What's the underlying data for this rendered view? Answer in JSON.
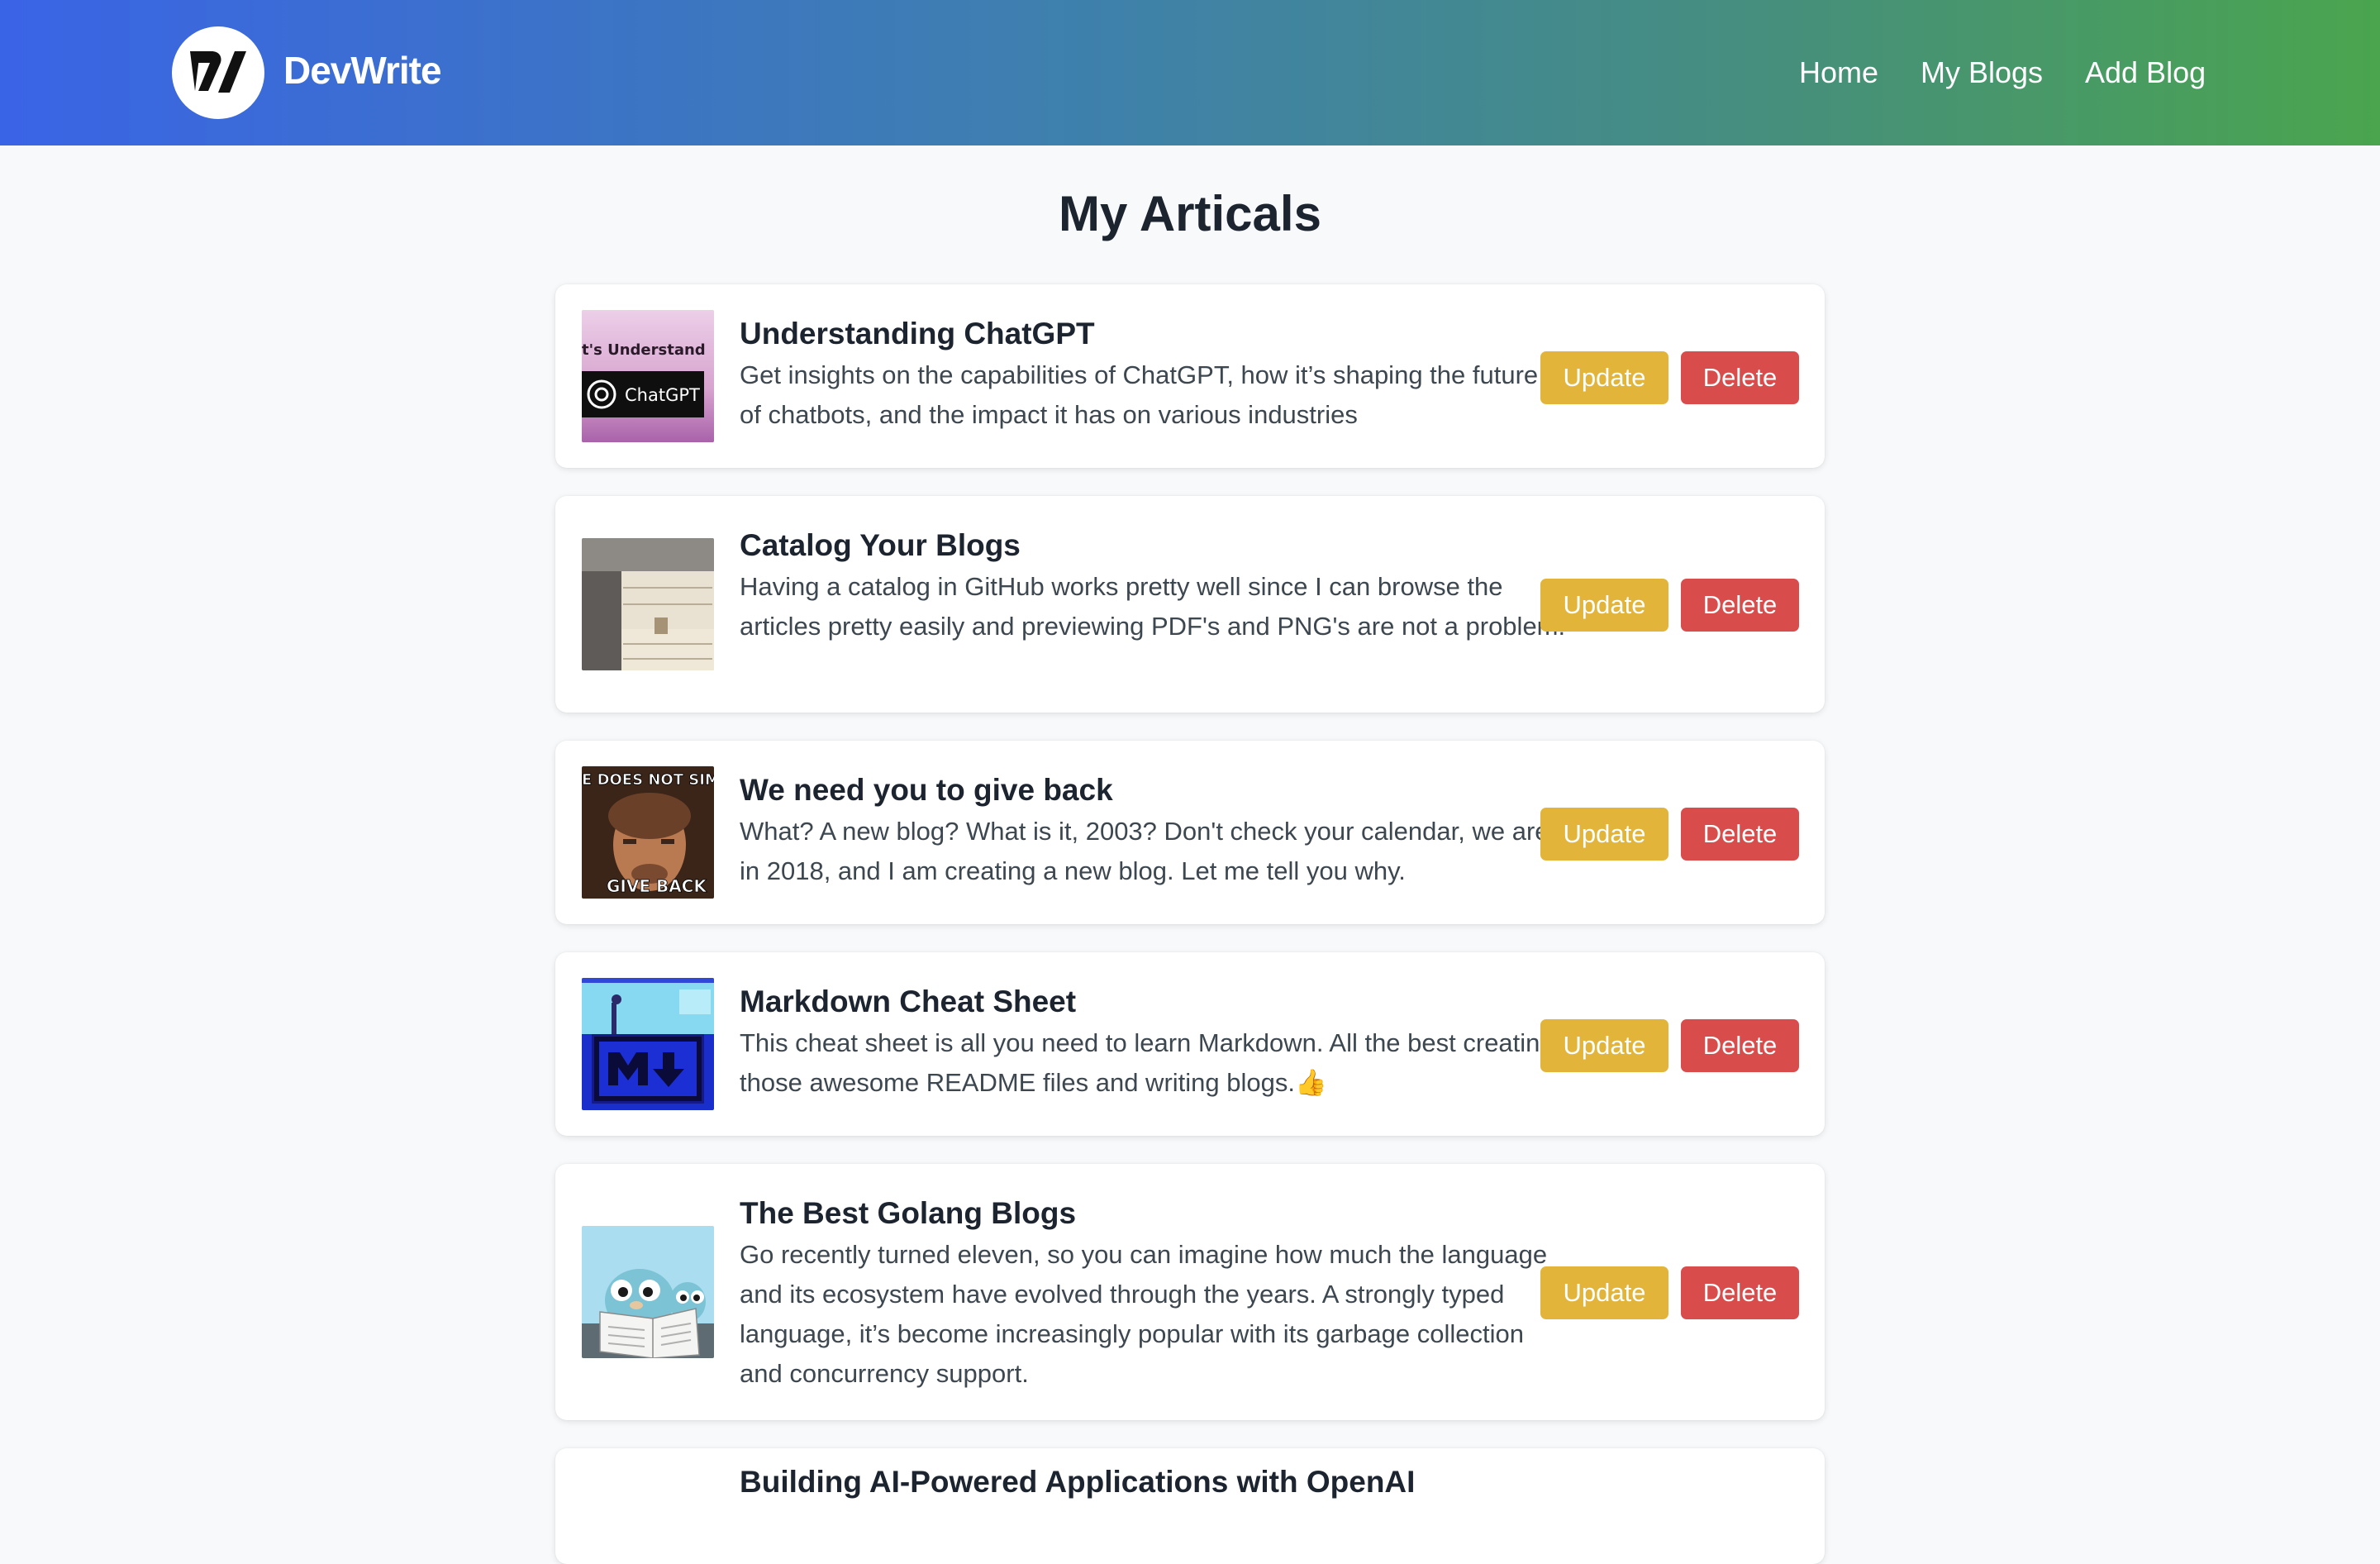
{
  "header": {
    "brand": "DevWrite",
    "nav": [
      {
        "label": "Home"
      },
      {
        "label": "My Blogs"
      },
      {
        "label": "Add Blog"
      }
    ],
    "gradient": [
      "#3a64e6",
      "#468f7c",
      "#4aa54e"
    ]
  },
  "page": {
    "title": "My Articals"
  },
  "actions": {
    "update_label": "Update",
    "delete_label": "Delete",
    "update_color": "#e2b43a",
    "delete_color": "#d94c4c"
  },
  "articles": [
    {
      "title": "Understanding ChatGPT",
      "description": "Get insights on the capabilities of ChatGPT, how it’s shaping the future of chatbots, and the impact it has on various industries",
      "thumb_text_top": "t's Understand",
      "thumb_text_badge": "ChatGPT"
    },
    {
      "title": "Catalog Your Blogs",
      "description": "Having a catalog in GitHub works pretty well since I can browse the articles pretty easily and previewing PDF's and PNG's are not a problem."
    },
    {
      "title": "We need you to give back",
      "description": "What? A new blog? What is it, 2003? Don't check your calendar, we are in 2018, and I am creating a new blog. Let me tell you why.",
      "thumb_text_top": "E DOES NOT SIMP",
      "thumb_text_bottom": "GIVE BACK"
    },
    {
      "title": "Markdown Cheat Sheet",
      "description": "This cheat sheet is all you need to learn Markdown. All the best creating those awesome README files and writing blogs.👍"
    },
    {
      "title": "The Best Golang Blogs",
      "description": "Go recently turned eleven, so you can imagine how much the language and its ecosystem have evolved through the years. A strongly typed language, it’s become increasingly popular with its garbage collection and concurrency support."
    },
    {
      "title": "Building AI-Powered Applications with OpenAI"
    }
  ]
}
